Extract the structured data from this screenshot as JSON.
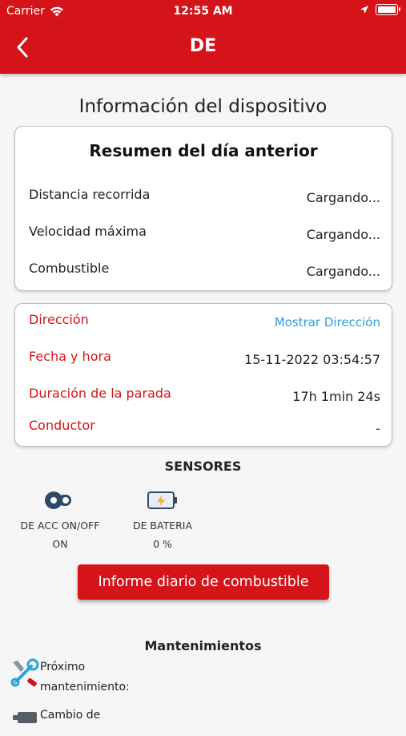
{
  "status_bar": {
    "carrier": "Carrier",
    "time": "12:55 AM"
  },
  "nav": {
    "title": "DE"
  },
  "page_title": "Información del dispositivo",
  "summary": {
    "title": "Resumen del día anterior",
    "rows": [
      {
        "label": "Distancia recorrida",
        "value": "Cargando..."
      },
      {
        "label": "Velocidad máxima",
        "value": "Cargando..."
      },
      {
        "label": "Combustible",
        "value": "Cargando..."
      }
    ]
  },
  "details": {
    "direccion_label": "Dirección",
    "direccion_link": "Mostrar Dirección",
    "fecha_label": "Fecha y hora",
    "fecha_value": "15-11-2022 03:54:57",
    "duracion_label": "Duración de la parada",
    "duracion_value": "17h 1min 24s",
    "conductor_label": "Conductor",
    "conductor_value": "-"
  },
  "sensors": {
    "title": "SENSORES",
    "items": [
      {
        "name": "DE ACC ON/OFF",
        "value": "ON",
        "icon": "ignition-key-icon"
      },
      {
        "name": "DE BATERIA",
        "value": "0 %",
        "icon": "battery-charging-icon"
      }
    ]
  },
  "fuel_report_button": "Informe diario de combustible",
  "maintenance": {
    "title": "Mantenimientos",
    "items": [
      {
        "label_line1": "Próximo",
        "label_line2": "mantenimiento:",
        "icon": "wrench-tools-icon"
      },
      {
        "label_line1": "Cambio de",
        "icon": "oil-change-icon"
      }
    ]
  },
  "colors": {
    "brand_red": "#d5141a",
    "link_blue": "#2a9fd8"
  }
}
